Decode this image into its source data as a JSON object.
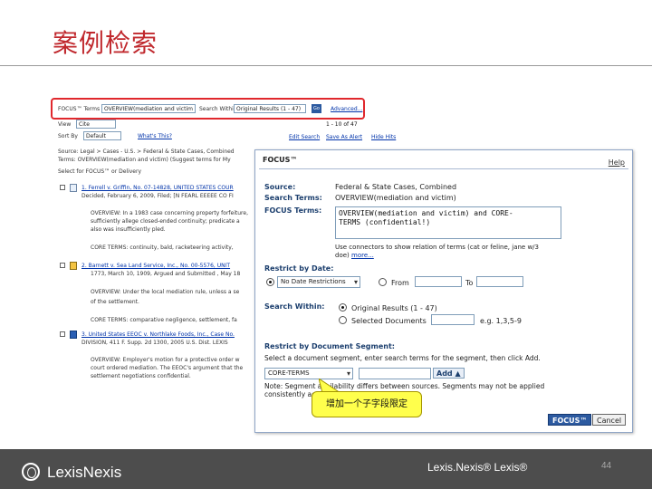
{
  "slide": {
    "title": "案例检索",
    "callout": "增加一个子字段限定",
    "page_number": "44"
  },
  "footer": {
    "logo_text": "LexisNexis",
    "center_text": "Lexis.Nexis® Lexis®"
  },
  "results": {
    "focus_label": "FOCUS™ Terms",
    "focus_value": "OVERVIEW(mediation and victim",
    "search_within_label": "Search Within",
    "search_within_value": "Original Results (1 - 47)",
    "go_label": "Go",
    "advanced_link": "Advanced...",
    "view_label": "View",
    "view_value": "Cite",
    "pagination": "1 - 10 of 47",
    "sort_label": "Sort By",
    "sort_value": "Default",
    "whats_this": "What's This?",
    "edit_search": "Edit Search",
    "save_alert": "Save As Alert",
    "hide_hits": "Hide Hits",
    "source_line": "Source: Legal > Cases - U.S. > Federal & State Cases, Combined",
    "terms_line": "Terms: OVERVIEW(mediation and victim) (Suggest terms for My",
    "select_line": "Select for FOCUS™ or Delivery",
    "item1_title": "1. Ferrell v. Griffin, No. 07-14828, UNITED STATES COUR",
    "item1_date": "Decided, February 6, 2009, Filed; [N FEARL EEEEE CO FI",
    "item1_overview": "OVERVIEW: In a 1983 case concerning property forfeiture,",
    "item1_overview2": "sufficiently allege closed-ended continuity; predicate a",
    "item1_overview3": "also was insufficiently pled.",
    "item1_core": "CORE TERMS: continuity, bald, racketeering activity,",
    "item2_title": "2. Barnett v. Sea Land Service, Inc., No. 00-5576, UNIT",
    "item2_date": "1773, March 10, 1909, Argued and Submitted , May 18",
    "item2_overview": "OVERVIEW: Under the local mediation rule, unless a se",
    "item2_overview2": "of the settlement.",
    "item2_core": "CORE TERMS: comparative negligence, settlement, fa",
    "item3_title": "3. United States EEOC v. Northlake Foods, Inc., Case No.",
    "item3_date": "DIVISION, 411 F. Supp. 2d 1300, 2005 U.S. Dist. LEXIS",
    "item3_overview": "OVERVIEW: Employer's motion for a protective order w",
    "item3_overview2": "court ordered mediation. The EEOC's argument that the",
    "item3_overview3": "settlement negotiations confidential."
  },
  "dialog": {
    "title": "FOCUS™",
    "help": "Help",
    "source_label": "Source:",
    "source_value": "Federal & State Cases, Combined",
    "search_terms_label": "Search Terms:",
    "search_terms_value": "OVERVIEW(mediation and victim)",
    "focus_terms_label": "FOCUS Terms:",
    "focus_terms_line1": "OVERVIEW(mediation and victim)   and CORE-",
    "focus_terms_line2": "TERMS (confidential!)",
    "connectors_hint": "Use connectors to show relation of terms (cat or feline, jane w/3",
    "connectors_hint2": "doe)",
    "more_link": "more...",
    "restrict_date_label": "Restrict by Date:",
    "date_option": "No Date Restrictions",
    "from_label": "From",
    "to_label": "To",
    "search_within_label": "Search Within:",
    "original_results": "Original Results (1 - 47)",
    "selected_docs": "Selected Documents",
    "eg_hint": "e.g. 1,3,5-9",
    "restrict_segment_label": "Restrict by Document Segment:",
    "segment_hint": "Select a document segment, enter search terms for the segment, then click Add.",
    "segment_value": "CORE-TERMS",
    "add_button": "Add",
    "note": "Note: Segment availability differs between sources. Segments may not be applied",
    "note2": "consistently across sources.",
    "focus_button": "FOCUS™",
    "cancel_button": "Cancel"
  },
  "colors": {
    "title_red": "#c0282d",
    "highlight_red": "#e0282d",
    "callout_yellow": "#ffff4c",
    "footer_gray": "#4d4d4d"
  }
}
